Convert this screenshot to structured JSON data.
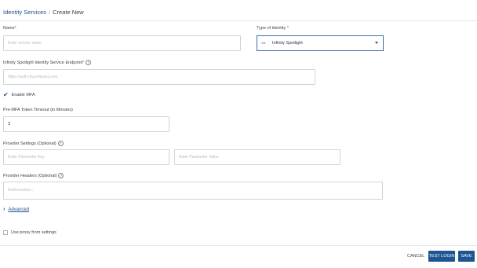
{
  "breadcrumb": {
    "parent": "Identity Services",
    "separator": "/",
    "current": "Create New"
  },
  "form": {
    "name": {
      "label": "Name",
      "required_mark": "*",
      "placeholder": "Enter service name",
      "value": ""
    },
    "type_of_identity": {
      "label": "Type of Identity",
      "required_mark": "*",
      "value": "Infinity Spotlight",
      "icon": "link-icon"
    },
    "endpoint": {
      "label": "Infinity Spotlight Identity Service Endpoint",
      "required_mark": "*",
      "help": "?",
      "placeholder": "https://auth.mycompany.com"
    },
    "enable_mfa": {
      "label": "Enable MFA",
      "checked": true
    },
    "mfa_timeout": {
      "label": "Pre-MFA Token Timeout (in Minutes)",
      "value": "3"
    },
    "provider_settings": {
      "label": "Provider Settings (Optional)",
      "help": "?",
      "key_placeholder": "Enter Parameter Key",
      "value_placeholder": "Enter Parameter Value"
    },
    "provider_headers": {
      "label": "Provider Headers (Optional)",
      "help": "?",
      "placeholder": "Authorization..."
    },
    "advanced": {
      "label": "Advanced",
      "chevron": "›"
    },
    "use_proxy": {
      "label": "Use proxy from settings",
      "checked": false
    }
  },
  "footer": {
    "cancel": "CANCEL",
    "test_login": "TEST LOGIN",
    "save": "SAVE"
  },
  "colors": {
    "accent": "#1d5592",
    "required": "#d83b3b",
    "link": "#1d4f8f"
  }
}
